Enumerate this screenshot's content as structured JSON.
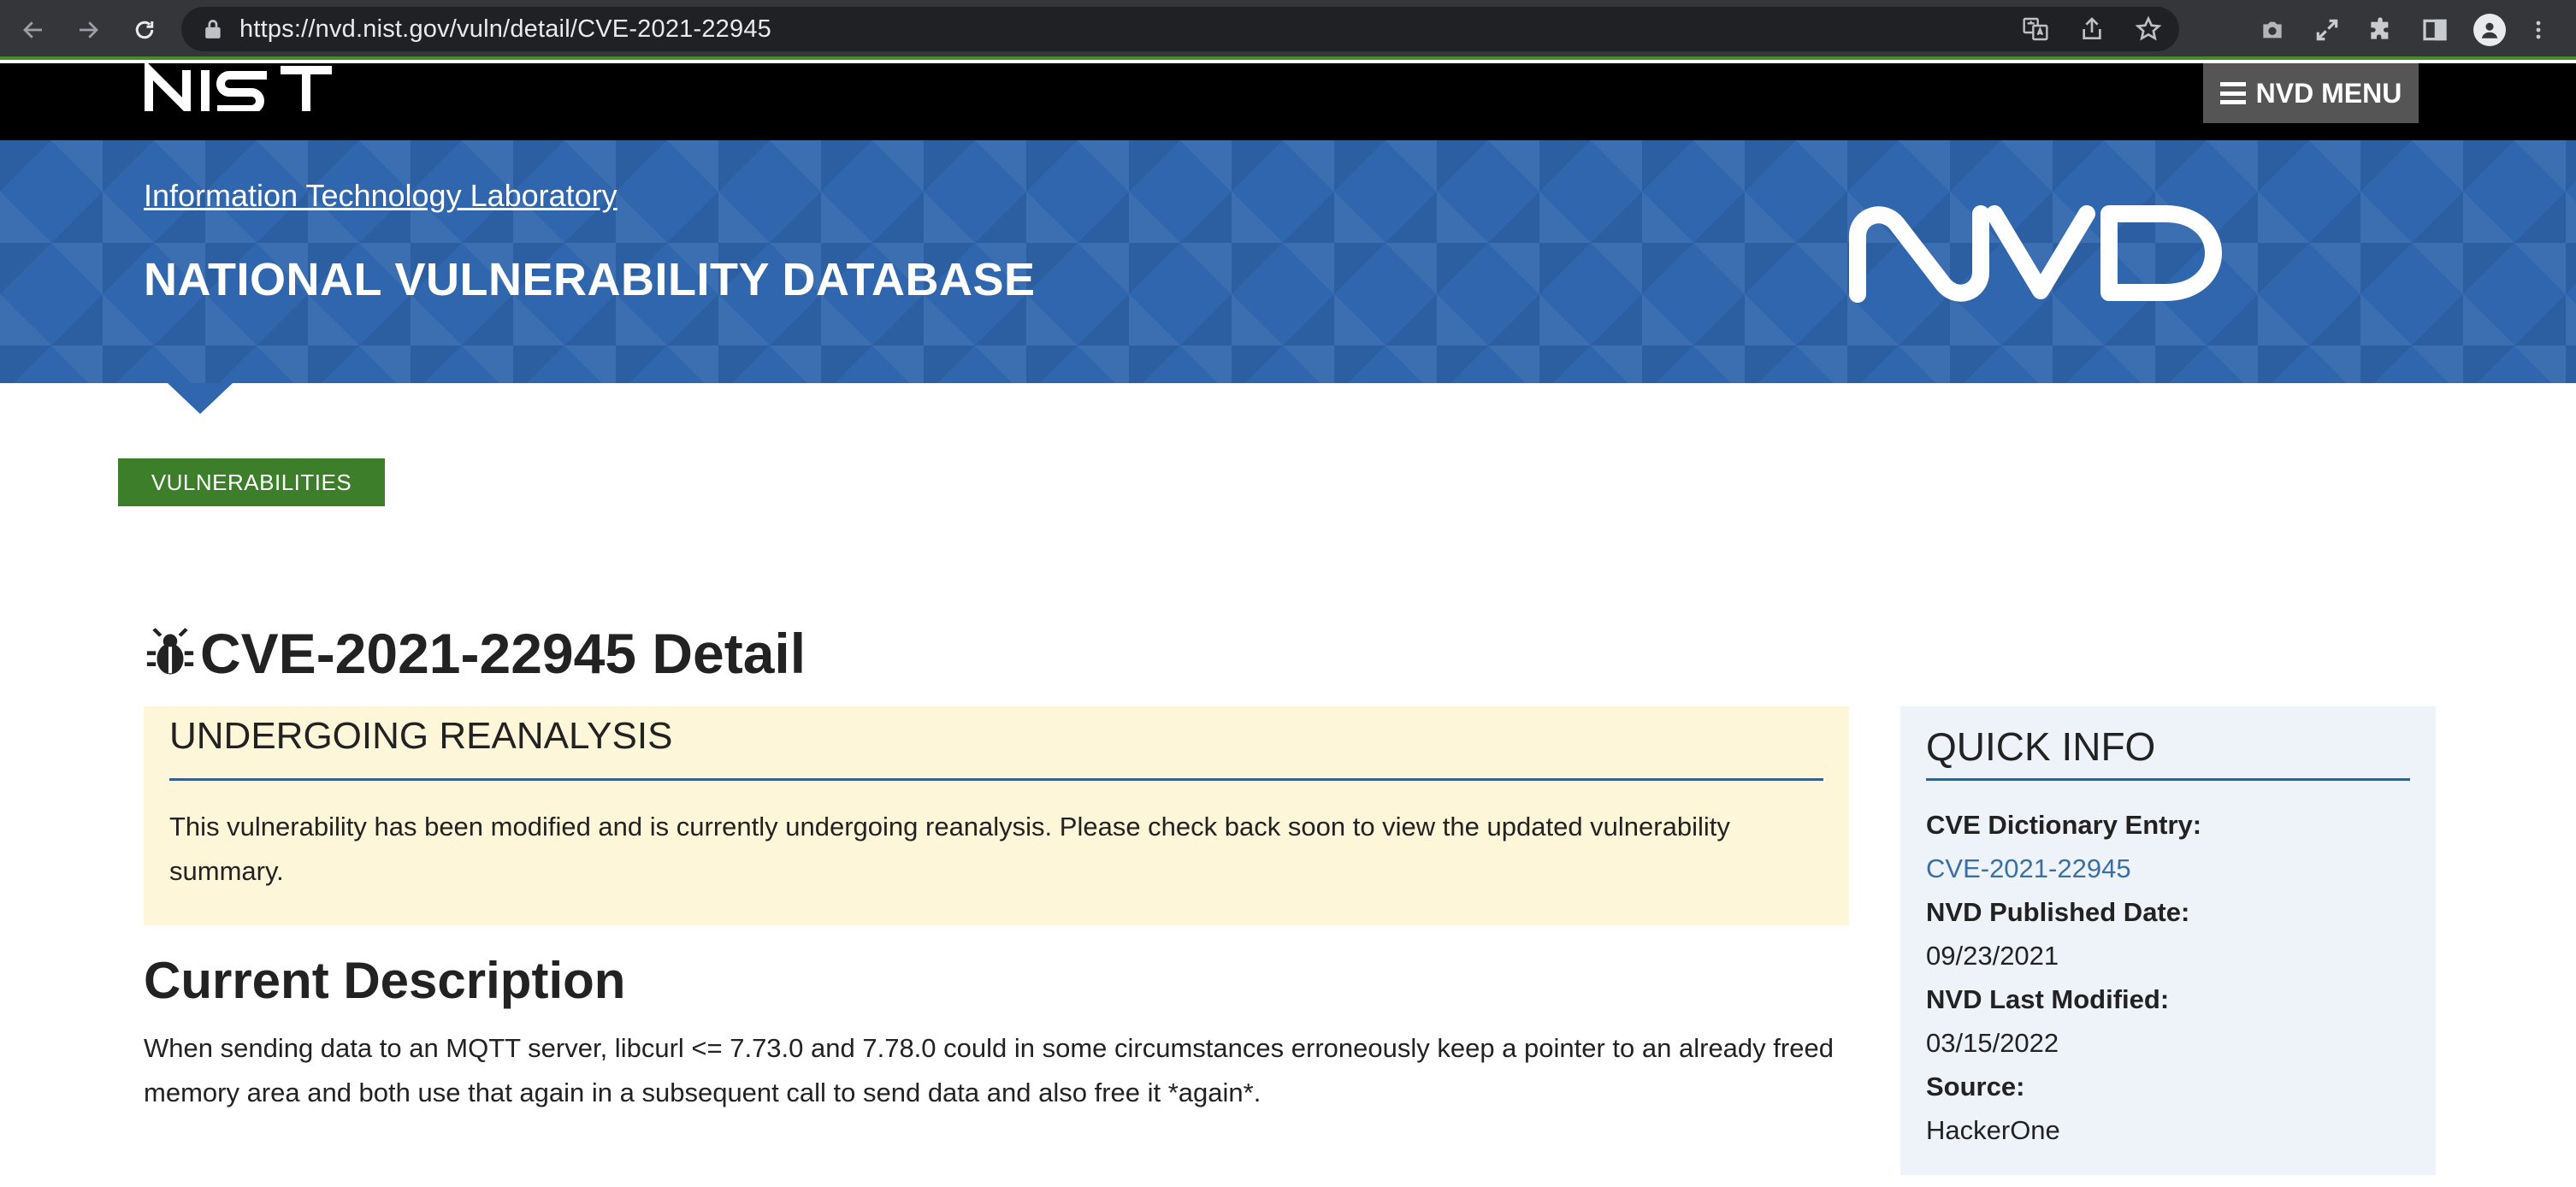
{
  "browser": {
    "url": "https://nvd.nist.gov/vuln/detail/CVE-2021-22945",
    "icons": [
      "back-icon",
      "forward-icon",
      "reload-icon",
      "lock-icon",
      "translate-icon",
      "share-icon",
      "bookmark-star-icon",
      "camera-icon",
      "expand-icon",
      "extensions-icon",
      "sidebar-icon",
      "profile-icon",
      "more-icon"
    ]
  },
  "header": {
    "nist_logo": "NIST",
    "menu_label": "NVD MENU"
  },
  "banner": {
    "itl_link": "Information Technology Laboratory",
    "title": "NATIONAL VULNERABILITY DATABASE",
    "logo": "NVD"
  },
  "breadcrumb": {
    "tag": "VULNERABILITIES"
  },
  "page": {
    "title": "CVE-2021-22945 Detail"
  },
  "alert": {
    "heading": "UNDERGOING REANALYSIS",
    "body": "This vulnerability has been modified and is currently undergoing reanalysis. Please check back soon to view the updated vulnerability summary."
  },
  "description": {
    "heading": "Current Description",
    "text": "When sending data to an MQTT server, libcurl <= 7.73.0 and 7.78.0 could in some circumstances erroneously keep a pointer to an already freed memory area and both use that again in a subsequent call to send data and also free it *again*."
  },
  "quick_info": {
    "heading": "QUICK INFO",
    "dict_label": "CVE Dictionary Entry:",
    "dict_value": "CVE-2021-22945",
    "published_label": "NVD Published Date:",
    "published_value": "09/23/2021",
    "modified_label": "NVD Last Modified:",
    "modified_value": "03/15/2022",
    "source_label": "Source:",
    "source_value": "HackerOne"
  },
  "colors": {
    "banner_blue": "#2f66ad",
    "tag_green": "#3d7e2a",
    "alert_bg": "#fdf6d8",
    "quickinfo_bg": "#eef3f9",
    "link_blue": "#3b6fa3"
  }
}
